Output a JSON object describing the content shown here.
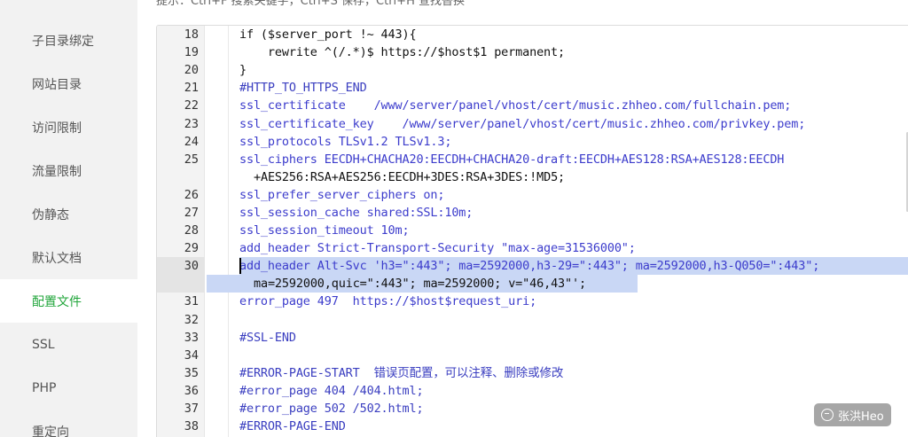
{
  "sidebar": {
    "items": [
      {
        "label": "子目录绑定",
        "active": false
      },
      {
        "label": "网站目录",
        "active": false
      },
      {
        "label": "访问限制",
        "active": false
      },
      {
        "label": "流量限制",
        "active": false
      },
      {
        "label": "伪静态",
        "active": false
      },
      {
        "label": "默认文档",
        "active": false
      },
      {
        "label": "配置文件",
        "active": true
      },
      {
        "label": "SSL",
        "active": false
      },
      {
        "label": "PHP",
        "active": false
      },
      {
        "label": "重定向",
        "active": false
      }
    ],
    "active_color": "#20a53a"
  },
  "hint": "提示：Ctrl+F 搜索关键字，Ctrl+S 保存，Ctrl+H 查找替换",
  "editor": {
    "line_numbers": [
      "18",
      "19",
      "20",
      "21",
      "22",
      "23",
      "24",
      "25",
      "26",
      "27",
      "28",
      "29",
      "30",
      "31",
      "32",
      "33",
      "34",
      "35",
      "36",
      "37",
      "38"
    ],
    "lines": {
      "l18": "if ($server_port !~ 443){",
      "l19": "    rewrite ^(/.*)$ https://$host$1 permanent;",
      "l20": "}",
      "l21": "#HTTP_TO_HTTPS_END",
      "l22": "ssl_certificate    /www/server/panel/vhost/cert/music.zhheo.com/fullchain.pem;",
      "l23": "ssl_certificate_key    /www/server/panel/vhost/cert/music.zhheo.com/privkey.pem;",
      "l24": "ssl_protocols TLSv1.2 TLSv1.3;",
      "l25a": "ssl_ciphers EECDH+CHACHA20:EECDH+CHACHA20-draft:EECDH+AES128:RSA+AES128:EECDH",
      "l25b": "+AES256:RSA+AES256:EECDH+3DES:RSA+3DES:!MD5;",
      "l26": "ssl_prefer_server_ciphers on;",
      "l27": "ssl_session_cache shared:SSL:10m;",
      "l28": "ssl_session_timeout 10m;",
      "l29": "add_header Strict-Transport-Security \"max-age=31536000\";",
      "l30a": "add_header Alt-Svc 'h3=\":443\"; ma=2592000,h3-29=\":443\"; ma=2592000,h3-Q050=\":443\";",
      "l30b": "ma=2592000,quic=\":443\"; ma=2592000; v=\"46,43\"';",
      "l31": "error_page 497  https://$host$request_uri;",
      "l32": "",
      "l33": "#SSL-END",
      "l34": "",
      "l35": "#ERROR-PAGE-START  错误页配置，可以注释、删除或修改",
      "l36": "#error_page 404 /404.html;",
      "l37": "#error_page 502 /502.html;",
      "l38": "#ERROR-PAGE-END"
    }
  },
  "watermark": "张洪Heo"
}
